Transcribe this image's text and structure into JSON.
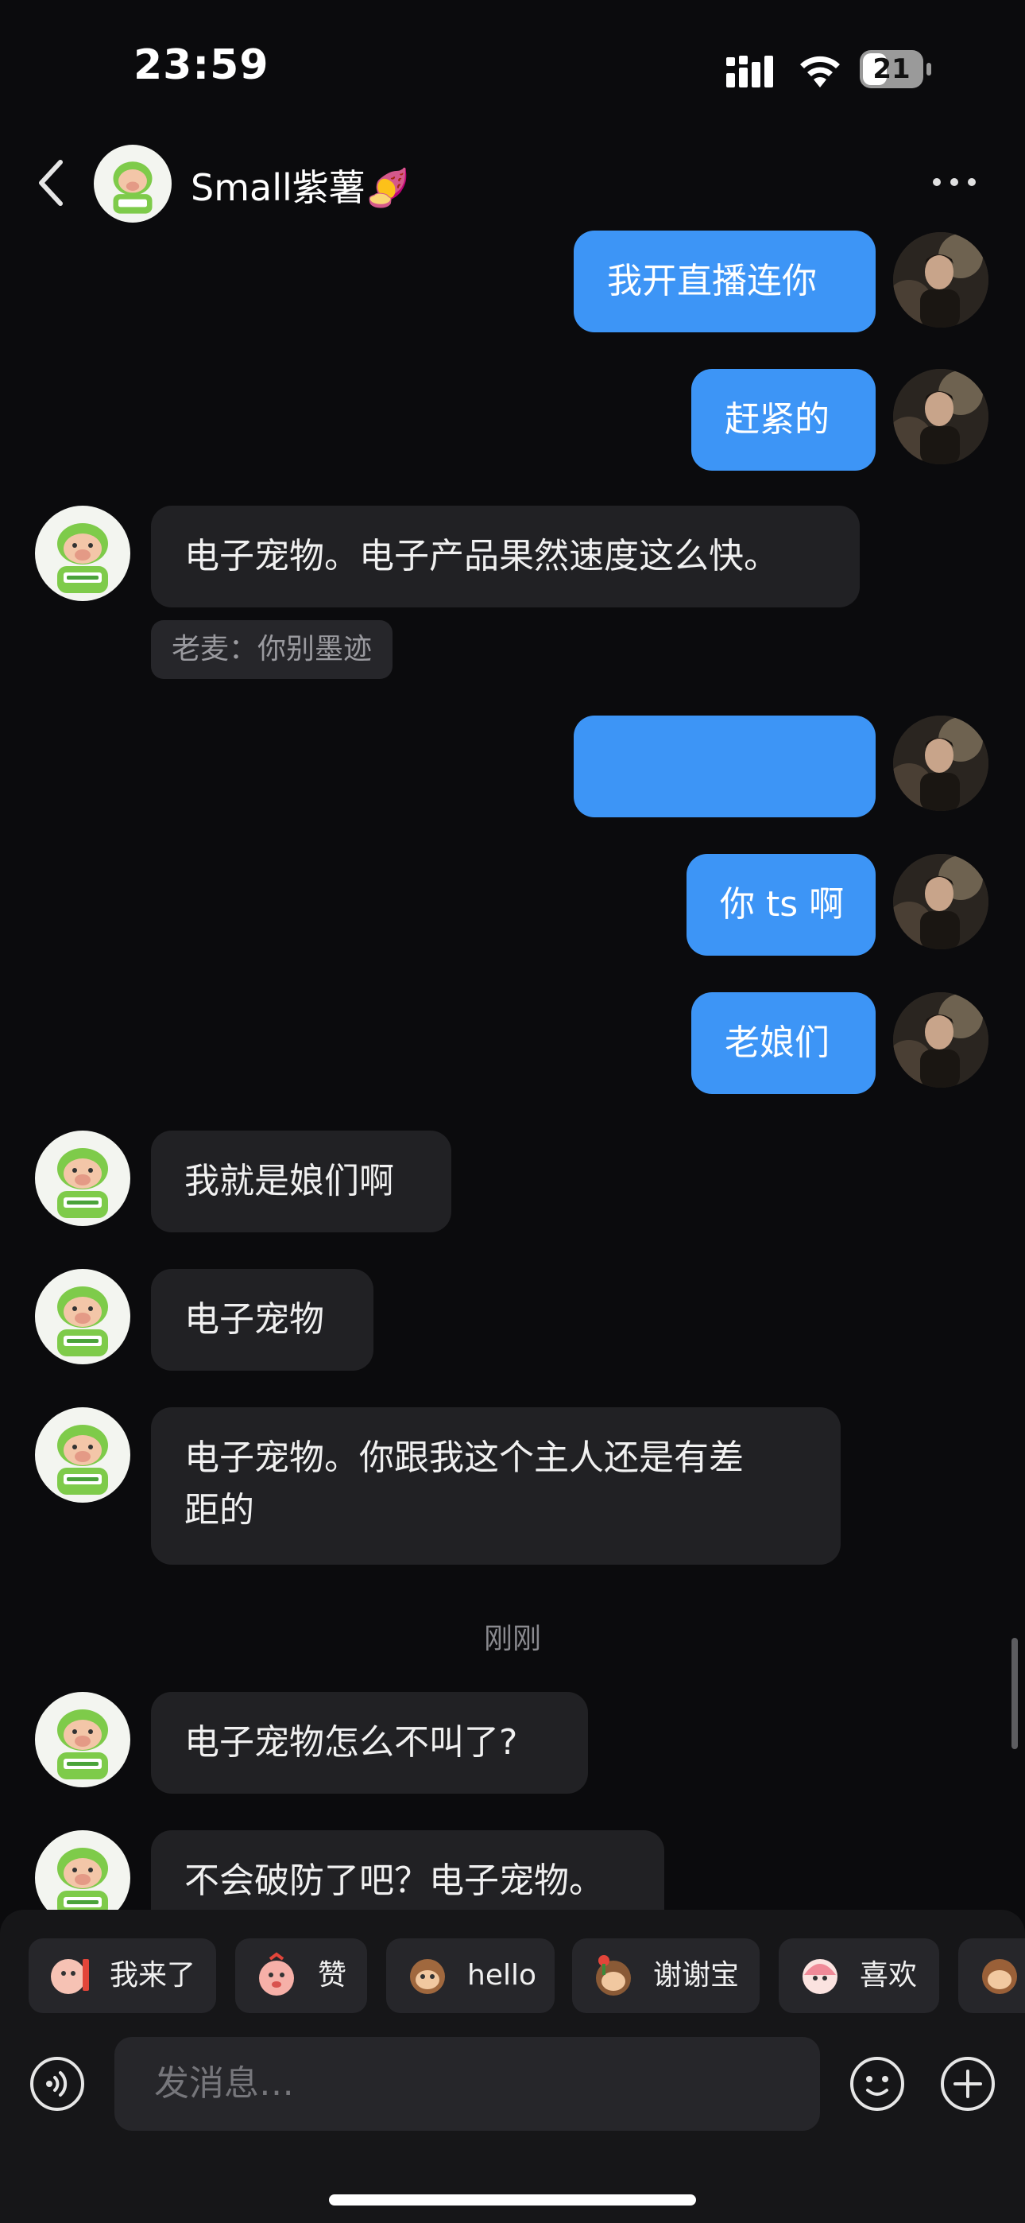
{
  "status_bar": {
    "time": "23:59",
    "battery": "21"
  },
  "header": {
    "contact_name": "Small紫薯🍠",
    "back_icon": "chevron-left-icon",
    "more_icon": "more-dots-icon"
  },
  "messages": [
    {
      "side": "out",
      "text": "我开直播连你"
    },
    {
      "side": "out",
      "text": "赶紧的"
    },
    {
      "side": "in",
      "text": "电子宠物。电子产品果然速度这么快。",
      "quote": "老麦：你别墨迹"
    },
    {
      "side": "out",
      "text": ""
    },
    {
      "side": "out",
      "text": "你 ts 啊"
    },
    {
      "side": "out",
      "text": "老娘们"
    },
    {
      "side": "in",
      "text": "我就是娘们啊"
    },
    {
      "side": "in",
      "text": "电子宠物"
    },
    {
      "side": "in",
      "text_line1": "电子宠物。你跟我这个主人还是有差",
      "text_line2": "距的"
    },
    {
      "side": "in",
      "text": "电子宠物怎么不叫了?"
    },
    {
      "side": "in",
      "text": "不会破防了吧？电子宠物。"
    }
  ],
  "timestamp": "刚刚",
  "quick_replies": [
    {
      "label": "我来了",
      "icon": "sticker-icon"
    },
    {
      "label": "赞",
      "icon": "sticker-icon"
    },
    {
      "label": "hello",
      "icon": "sticker-icon"
    },
    {
      "label": "谢谢宝",
      "icon": "sticker-icon"
    },
    {
      "label": "喜欢",
      "icon": "sticker-icon"
    }
  ],
  "composer": {
    "placeholder": "发消息…"
  },
  "colors": {
    "background": "#0b0b0d",
    "outgoing": "#3d95f6",
    "incoming": "#212124"
  }
}
